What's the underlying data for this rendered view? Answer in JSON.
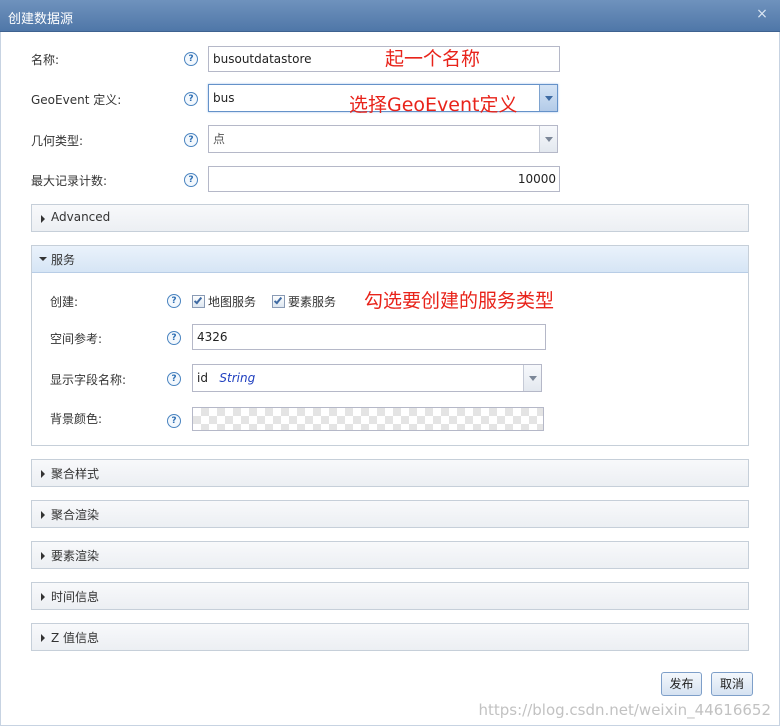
{
  "dialog": {
    "title": "创建数据源",
    "close_glyph": "×"
  },
  "form": {
    "name": {
      "label": "名称:",
      "value": "busoutdatastore"
    },
    "geoevent": {
      "label": "GeoEvent 定义:",
      "value": "bus"
    },
    "geometry": {
      "label": "几何类型:",
      "value": "点"
    },
    "max_records": {
      "label": "最大记录计数:",
      "value": "10000"
    },
    "help_glyph": "?"
  },
  "panels": {
    "advanced": {
      "title": "Advanced",
      "expanded": false
    },
    "service": {
      "title": "服务",
      "expanded": true,
      "create_label": "创建:",
      "map_service": {
        "label": "地图服务",
        "checked": true
      },
      "feature_service": {
        "label": "要素服务",
        "checked": true
      },
      "spatial_ref": {
        "label": "空间参考:",
        "value": "4326"
      },
      "display_field": {
        "label": "显示字段名称:",
        "field": "id",
        "type": "String"
      },
      "bg_color": {
        "label": "背景颜色:"
      }
    },
    "aggregation_style": {
      "title": "聚合样式",
      "expanded": false
    },
    "aggregation_render": {
      "title": "聚合渲染",
      "expanded": false
    },
    "feature_render": {
      "title": "要素渲染",
      "expanded": false
    },
    "time_info": {
      "title": "时间信息",
      "expanded": false
    },
    "z_info": {
      "title": "Z 值信息",
      "expanded": false
    }
  },
  "buttons": {
    "publish": "发布",
    "cancel": "取消"
  },
  "annotations": {
    "name_hint": "起一个名称",
    "geoevent_hint": "选择GeoEvent定义",
    "service_hint": "勾选要创建的服务类型"
  },
  "watermark": "https://blog.csdn.net/weixin_44616652",
  "colors": {
    "title_bar": "#5a80b0",
    "annotation": "#e8231a",
    "accent_text": "#1f3fbf"
  }
}
